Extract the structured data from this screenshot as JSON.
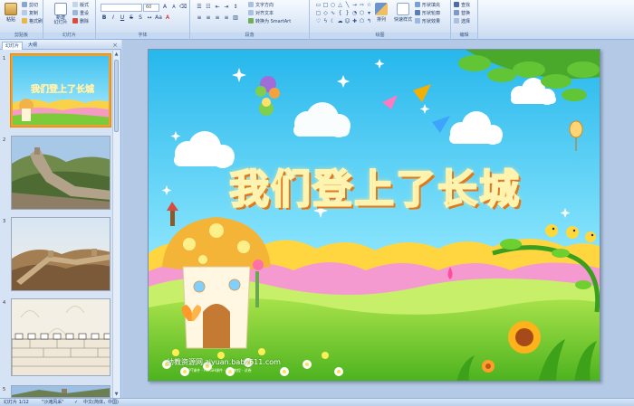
{
  "ribbon": {
    "clipboard": {
      "label": "剪贴板",
      "paste": "粘贴",
      "cut": "剪切",
      "copy": "复制",
      "format_painter": "格式刷"
    },
    "slides": {
      "label": "幻灯片",
      "new_slide": "新建\n幻灯片",
      "layout": "版式",
      "reset": "重设",
      "delete": "删除"
    },
    "font": {
      "label": "字体",
      "size_value": "60"
    },
    "paragraph": {
      "label": "段落",
      "text_direction": "文字方向",
      "align_text": "对齐文本",
      "smartart": "转换为 SmartArt"
    },
    "drawing": {
      "label": "绘图",
      "arrange": "排列",
      "quick_styles": "快速样式",
      "shape_fill": "形状填充",
      "shape_outline": "形状轮廓",
      "shape_effects": "形状效果"
    },
    "editing": {
      "label": "编辑",
      "find": "查找",
      "replace": "替换",
      "select": "选择"
    }
  },
  "pane": {
    "tab_slides": "幻灯片",
    "tab_outline": "大纲",
    "close": "×",
    "slides": [
      {
        "num": "1"
      },
      {
        "num": "2"
      },
      {
        "num": "3"
      },
      {
        "num": "4"
      },
      {
        "num": "5"
      }
    ],
    "thumb1_title": "我们登上了长城"
  },
  "slide": {
    "title": "我们登上了长城",
    "watermark": "幼教资源网 ziyuan.baby611.com",
    "watermark_sub": "PPT课件 · FLASH课件 · 教案教程 · 试卷"
  },
  "status": {
    "slide_info": "幻灯片 1/12",
    "theme": "\"沙滩风采\"",
    "language": "中文(简体，中国)"
  },
  "colors": {
    "ribbon_bg": "#dde8f7",
    "title_fill": "#f5a21b",
    "title_shadow": "#e0781c",
    "selection": "#f0a030"
  }
}
